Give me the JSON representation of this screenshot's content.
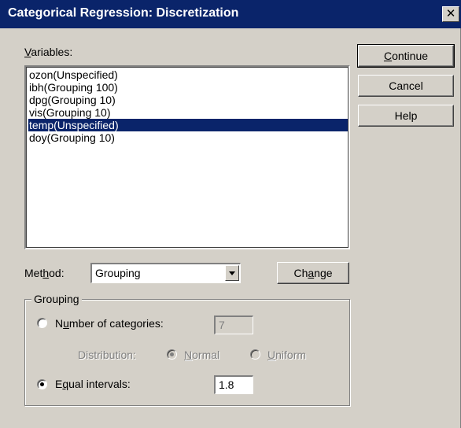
{
  "window": {
    "title": "Categorical Regression: Discretization",
    "close_glyph": "✕"
  },
  "variables": {
    "label_pre": "",
    "label_accel": "V",
    "label_post": "ariables:",
    "items": [
      "ozon(Unspecified)",
      "ibh(Grouping 100)",
      "dpg(Grouping 10)",
      "vis(Grouping 10)",
      "temp(Unspecified)",
      "doy(Grouping 10)"
    ],
    "selected_index": 4
  },
  "buttons": {
    "continue_pre": "",
    "continue_accel": "C",
    "continue_post": "ontinue",
    "cancel": "Cancel",
    "help": "Help",
    "change_pre": "Ch",
    "change_accel": "a",
    "change_post": "nge"
  },
  "method": {
    "label_pre": "Met",
    "label_accel": "h",
    "label_post": "od:",
    "value": "Grouping"
  },
  "grouping": {
    "title": "Grouping",
    "num_categories_pre": "N",
    "num_categories_accel": "u",
    "num_categories_post": "mber of categories:",
    "num_categories_value": "7",
    "distribution_label": "Distribution:",
    "normal_pre": "",
    "normal_accel": "N",
    "normal_post": "ormal",
    "uniform_pre": "",
    "uniform_accel": "U",
    "uniform_post": "niform",
    "equal_pre": "E",
    "equal_accel": "q",
    "equal_post": "ual intervals:",
    "equal_value": "1.8",
    "selected_option": "equal_intervals",
    "distribution_selected": "normal"
  },
  "colors": {
    "titlebar": "#0a246a",
    "face": "#d4d0c8",
    "selection": "#0a246a"
  }
}
